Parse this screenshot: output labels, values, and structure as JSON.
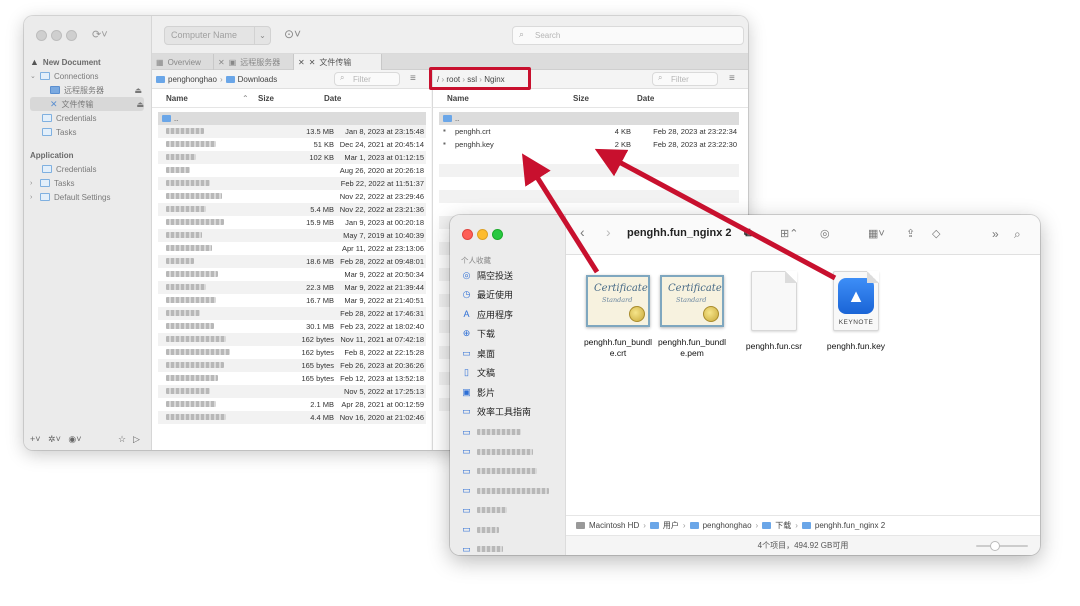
{
  "ssh_client": {
    "sidebar": {
      "items": [
        {
          "label": "New Document",
          "kind": "doc"
        },
        {
          "label": "Connections",
          "kind": "folder"
        },
        {
          "label": "远程服务器",
          "kind": "sub"
        },
        {
          "label": "文件传输",
          "kind": "sub"
        },
        {
          "label": "Credentials",
          "kind": "folder"
        },
        {
          "label": "Tasks",
          "kind": "folder"
        }
      ],
      "app_group": "Application",
      "app_items": [
        {
          "label": "Credentials"
        },
        {
          "label": "Tasks"
        },
        {
          "label": "Default Settings"
        }
      ]
    },
    "toolbar": {
      "computer_placeholder": "Computer Name",
      "search_placeholder": "Search"
    },
    "tabs": [
      {
        "label": "Overview"
      },
      {
        "label": "远程服务器"
      },
      {
        "label": "文件传输"
      }
    ],
    "left_pane": {
      "breadcrumb": [
        "penghonghao",
        "Downloads"
      ],
      "filter_placeholder": "Filter",
      "col_name": "Name",
      "col_size": "Size",
      "col_date": "Date",
      "rows": [
        {
          "size": "",
          "date": ""
        },
        {
          "size": "13.5 MB",
          "date": "Jan 8, 2023 at 23:15:48"
        },
        {
          "size": "51 KB",
          "date": "Dec 24, 2021 at 20:45:14"
        },
        {
          "size": "102 KB",
          "date": "Mar 1, 2023 at 01:12:15"
        },
        {
          "size": "",
          "date": "Aug 26, 2020 at 20:26:18"
        },
        {
          "size": "",
          "date": "Feb 22, 2022 at 11:51:37"
        },
        {
          "size": "",
          "date": "Nov 22, 2022 at 23:29:46"
        },
        {
          "size": "5.4 MB",
          "date": "Nov 22, 2022 at 23:21:36"
        },
        {
          "size": "15.9 MB",
          "date": "Jan 9, 2023 at 00:20:18"
        },
        {
          "size": "",
          "date": "May 7, 2019 at 10:40:39"
        },
        {
          "size": "",
          "date": "Apr 11, 2022 at 23:13:06"
        },
        {
          "size": "18.6 MB",
          "date": "Feb 28, 2022 at 09:48:01"
        },
        {
          "size": "",
          "date": "Mar 9, 2022 at 20:50:34"
        },
        {
          "size": "22.3 MB",
          "date": "Mar 9, 2022 at 21:39:44"
        },
        {
          "size": "16.7 MB",
          "date": "Mar 9, 2022 at 21:40:51"
        },
        {
          "size": "",
          "date": "Feb 28, 2022 at 17:46:31"
        },
        {
          "size": "30.1 MB",
          "date": "Feb 23, 2022 at 18:02:40"
        },
        {
          "size": "162 bytes",
          "date": "Nov 11, 2021 at 07:42:18"
        },
        {
          "size": "162 bytes",
          "date": "Feb 8, 2022 at 22:15:28"
        },
        {
          "size": "165 bytes",
          "date": "Feb 26, 2023 at 20:36:26"
        },
        {
          "size": "165 bytes",
          "date": "Feb 12, 2023 at 13:52:18"
        },
        {
          "size": "",
          "date": "Nov 5, 2022 at 17:25:13"
        },
        {
          "size": "2.1 MB",
          "date": "Apr 28, 2021 at 00:12:59"
        },
        {
          "size": "4.4 MB",
          "date": "Nov 16, 2020 at 21:02:46"
        }
      ]
    },
    "right_pane": {
      "breadcrumb": [
        "/",
        "root",
        "ssl",
        "Nginx"
      ],
      "filter_placeholder": "Filter",
      "col_name": "Name",
      "col_size": "Size",
      "col_date": "Date",
      "rows": [
        {
          "name": "..",
          "size": "",
          "date": ""
        },
        {
          "name": "penghh.crt",
          "size": "4 KB",
          "date": "Feb 28, 2023 at 23:22:34"
        },
        {
          "name": "penghh.key",
          "size": "2 KB",
          "date": "Feb 28, 2023 at 23:22:30"
        }
      ]
    }
  },
  "finder": {
    "title": "penghh.fun_nginx 2",
    "sidebar_group": "个人收藏",
    "sidebar": [
      {
        "label": "隔空投送",
        "icon": "airdrop-icon",
        "glyph": "◎"
      },
      {
        "label": "最近使用",
        "icon": "clock-icon",
        "glyph": "◷"
      },
      {
        "label": "应用程序",
        "icon": "applications-icon",
        "glyph": "A"
      },
      {
        "label": "下载",
        "icon": "download-icon",
        "glyph": "⊕"
      },
      {
        "label": "桌面",
        "icon": "desktop-icon",
        "glyph": "▭"
      },
      {
        "label": "文稿",
        "icon": "document-icon",
        "glyph": "▯"
      },
      {
        "label": "影片",
        "icon": "movies-icon",
        "glyph": "▣"
      },
      {
        "label": "效率工具指南",
        "icon": "folder-icon",
        "glyph": "▭"
      }
    ],
    "files": [
      {
        "name": "penghh.fun_bundle.crt",
        "line1": "penghh.fun_bundl",
        "line2": "e.crt",
        "type": "cert"
      },
      {
        "name": "penghh.fun_bundle.pem",
        "line1": "penghh.fun_bundl",
        "line2": "e.pem",
        "type": "cert"
      },
      {
        "name": "penghh.fun.csr",
        "line1": "penghh.fun.csr",
        "line2": "",
        "type": "doc"
      },
      {
        "name": "penghh.fun.key",
        "line1": "penghh.fun.key",
        "line2": "",
        "type": "keynote"
      }
    ],
    "cert_title": "Certificate",
    "cert_sub": "Standard",
    "keynote_caption": "KEYNOTE",
    "path": [
      "Macintosh HD",
      "用户",
      "penghonghao",
      "下载",
      "penghh.fun_nginx 2"
    ],
    "status": "4个项目，494.92 GB可用"
  },
  "colors": {
    "annotation_red": "#c8102e",
    "folder_blue": "#5a9de6"
  }
}
